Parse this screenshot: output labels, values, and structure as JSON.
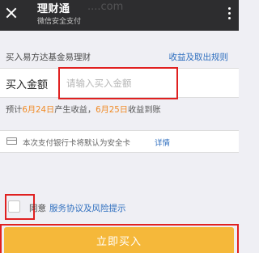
{
  "header": {
    "title": "理财通",
    "subtitle": "微信安全支付",
    "watermark": "....com"
  },
  "product": {
    "name": "买入易方达基金易理财",
    "rules_link": "收益及取出规则"
  },
  "amount": {
    "label": "买入金额",
    "placeholder": "请输入买入金额",
    "value": ""
  },
  "estimate": {
    "prefix": "预计",
    "income_date": "6月24日",
    "income_text": "产生收益，",
    "arrival_date": "6月25日",
    "arrival_text": "收益到账"
  },
  "card_notice": {
    "text": "本次支付银行卡将默认为安全卡",
    "detail_link": "详情"
  },
  "agreement": {
    "checked": false,
    "label": "同意",
    "link": "服务协议及风险提示"
  },
  "buy_button": {
    "label": "立即买入"
  },
  "colors": {
    "titlebar": "#2d2d2f",
    "link": "#2f6fbf",
    "highlight_date": "#f08a24",
    "buy_button": "#f5b83a",
    "annotation_red": "#e02020"
  },
  "icons": [
    "close-icon",
    "more-icon",
    "bank-card-icon"
  ]
}
